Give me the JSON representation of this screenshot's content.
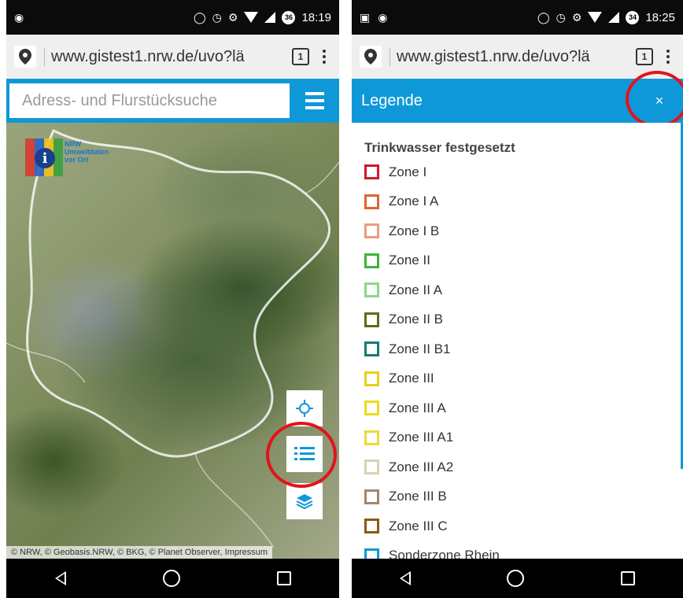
{
  "left_screen": {
    "status": {
      "time": "18:19"
    },
    "browser": {
      "url": "www.gistest1.nrw.de/uvo?lä",
      "tab_count": "1"
    },
    "search": {
      "placeholder": "Adress- und Flurstücksuche"
    },
    "logo": {
      "text": "NRW\nUmweltdaten\nvor Ort"
    },
    "map_controls": [
      {
        "name": "locate",
        "icon": "crosshair-icon"
      },
      {
        "name": "legend",
        "icon": "list-icon"
      },
      {
        "name": "layers",
        "icon": "layers-icon"
      }
    ],
    "attribution": "© NRW, © Geobasis.NRW, © BKG, © Planet Observer, Impressum"
  },
  "right_screen": {
    "status": {
      "time": "18:25"
    },
    "browser": {
      "url": "www.gistest1.nrw.de/uvo?lä",
      "tab_count": "1"
    },
    "legend": {
      "title": "Legende",
      "close_label": "×",
      "section": "Trinkwasser festgesetzt",
      "items": [
        {
          "label": "Zone I",
          "color": "#d0182a"
        },
        {
          "label": "Zone I A",
          "color": "#e2632d"
        },
        {
          "label": "Zone I B",
          "color": "#eb9b80"
        },
        {
          "label": "Zone II",
          "color": "#39b53a"
        },
        {
          "label": "Zone II A",
          "color": "#8fd68a"
        },
        {
          "label": "Zone II B",
          "color": "#5c6e14"
        },
        {
          "label": "Zone II B1",
          "color": "#167a74"
        },
        {
          "label": "Zone III",
          "color": "#e6d119"
        },
        {
          "label": "Zone III A",
          "color": "#ecdc1a"
        },
        {
          "label": "Zone III A1",
          "color": "#eedb32"
        },
        {
          "label": "Zone III A2",
          "color": "#d9d3b3"
        },
        {
          "label": "Zone III B",
          "color": "#a3866d"
        },
        {
          "label": "Zone III C",
          "color": "#8a5a14"
        },
        {
          "label": "Sonderzone Rhein",
          "color": "#0f98d8"
        }
      ]
    }
  },
  "colors": {
    "accent": "#0f98d8",
    "highlight": "#e3131b"
  }
}
